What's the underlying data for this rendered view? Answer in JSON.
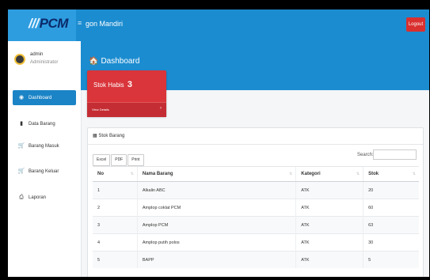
{
  "brand": {
    "logo_text": "PCM",
    "logo_bars": "///"
  },
  "topbar": {
    "app_title": "gon Mandiri",
    "menu_toggle": "≡",
    "logout_label": "Logout"
  },
  "user": {
    "name": "admin",
    "role": "Administrator"
  },
  "sidebar": {
    "items": [
      {
        "label": "Dashboard",
        "icon": "dashboard-icon",
        "glyph": "◉",
        "active": true
      },
      {
        "label": "Data Barang",
        "icon": "box-icon",
        "glyph": "▮",
        "active": false
      },
      {
        "label": "Barang Masuk",
        "icon": "cart-in-icon",
        "glyph": "🛒",
        "active": false
      },
      {
        "label": "Barang Keluar",
        "icon": "cart-out-icon",
        "glyph": "🛒",
        "active": false
      },
      {
        "label": "Laporan",
        "icon": "print-icon",
        "glyph": "⎙",
        "active": false
      }
    ]
  },
  "header": {
    "title": "Dashboard",
    "icon": "home-icon",
    "glyph": "🏠"
  },
  "stok_card": {
    "label": "Stok Habis",
    "count": "3",
    "link_label": "View Details",
    "arrow": "›"
  },
  "panel": {
    "title": "Stok Barang",
    "buttons": [
      "Excel",
      "PDF",
      "Print"
    ],
    "search_label": "Search:",
    "search_value": "",
    "columns": [
      "No",
      "Nama Barang",
      "Kategori",
      "Stok"
    ],
    "sort_glyph": "⇅",
    "rows": [
      [
        "1",
        "Alkalin ABC",
        "ATK",
        "20"
      ],
      [
        "2",
        "Amplop coklat PCM",
        "ATK",
        "60"
      ],
      [
        "3",
        "Amplop PCM",
        "ATK",
        "63"
      ],
      [
        "4",
        "Amplop putih polos",
        "ATK",
        "30"
      ],
      [
        "5",
        "BAPP",
        "ATK",
        "5"
      ]
    ]
  },
  "colors": {
    "primary": "#1c8cd0",
    "danger": "#d9353a",
    "logout": "#d9302f",
    "sidebar_active": "#1b84c6"
  }
}
